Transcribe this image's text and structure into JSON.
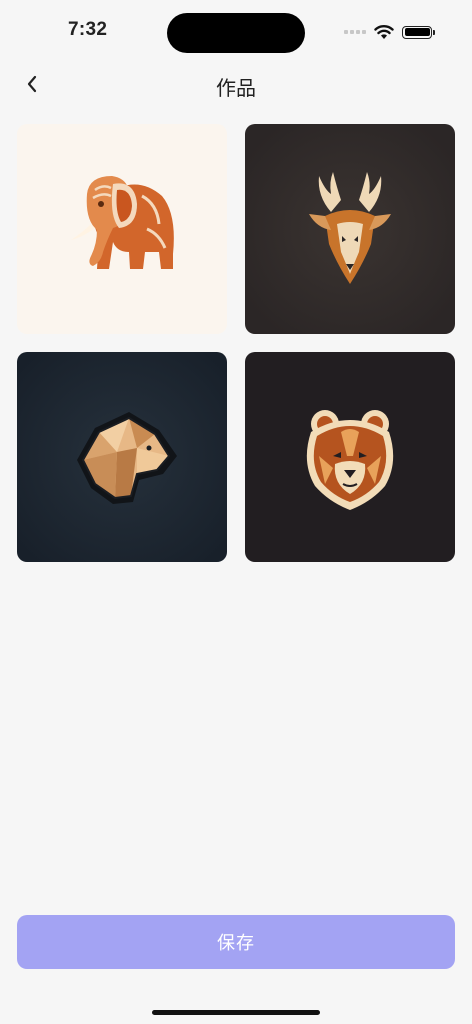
{
  "status_bar": {
    "time": "7:32",
    "icons": [
      "signal-icon",
      "wifi-icon",
      "battery-icon"
    ]
  },
  "header": {
    "back_icon": "chevron-left-icon",
    "title": "作品"
  },
  "gallery": {
    "items": [
      {
        "subject": "elephant-logo",
        "background": "#fbf5ee"
      },
      {
        "subject": "deer-logo",
        "background": "#2d2828"
      },
      {
        "subject": "bear-geometric-logo",
        "background": "#1b222b"
      },
      {
        "subject": "bear-face-logo",
        "background": "#221e21"
      }
    ]
  },
  "actions": {
    "save_label": "保存"
  },
  "colors": {
    "accent": "#a3a3f3",
    "background": "#f6f6f6"
  }
}
